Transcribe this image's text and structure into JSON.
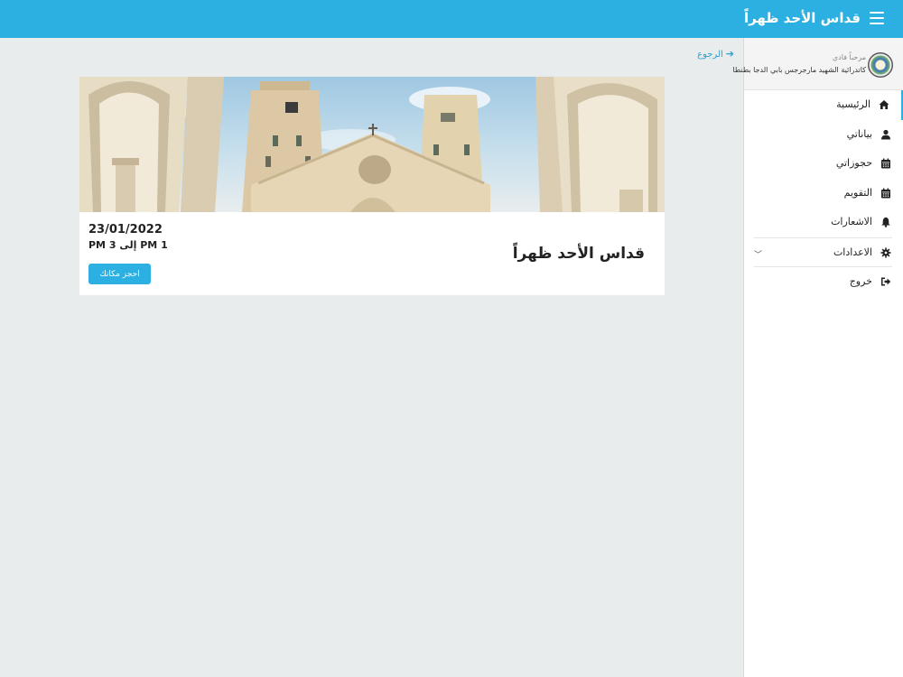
{
  "header": {
    "title": "قداس الأحد ظهراً",
    "bg_color": "#2bb0e1"
  },
  "profile": {
    "greeting": "مرحباً فادي",
    "church": "كاتدرائية الشهيد مارجرجس بابي الدجا بطنطا"
  },
  "menu": {
    "items": [
      {
        "label": "الرئيسية",
        "icon": "home-icon"
      },
      {
        "label": "بياناتي",
        "icon": "user-icon"
      },
      {
        "label": "حجوزاتي",
        "icon": "calendar-icon"
      },
      {
        "label": "التقويم",
        "icon": "calendar-icon"
      },
      {
        "label": "الاشعارات",
        "icon": "bell-icon"
      },
      {
        "label": "الاعدادات",
        "icon": "gear-icon"
      },
      {
        "label": "خروج",
        "icon": "sign-out-icon"
      }
    ]
  },
  "back_link": "الرجوع",
  "event": {
    "title": "قداس الأحد ظهراً",
    "date": "23/01/2022",
    "time": "1 PM إلى 3 PM",
    "book_label": "احجز مكانك"
  }
}
